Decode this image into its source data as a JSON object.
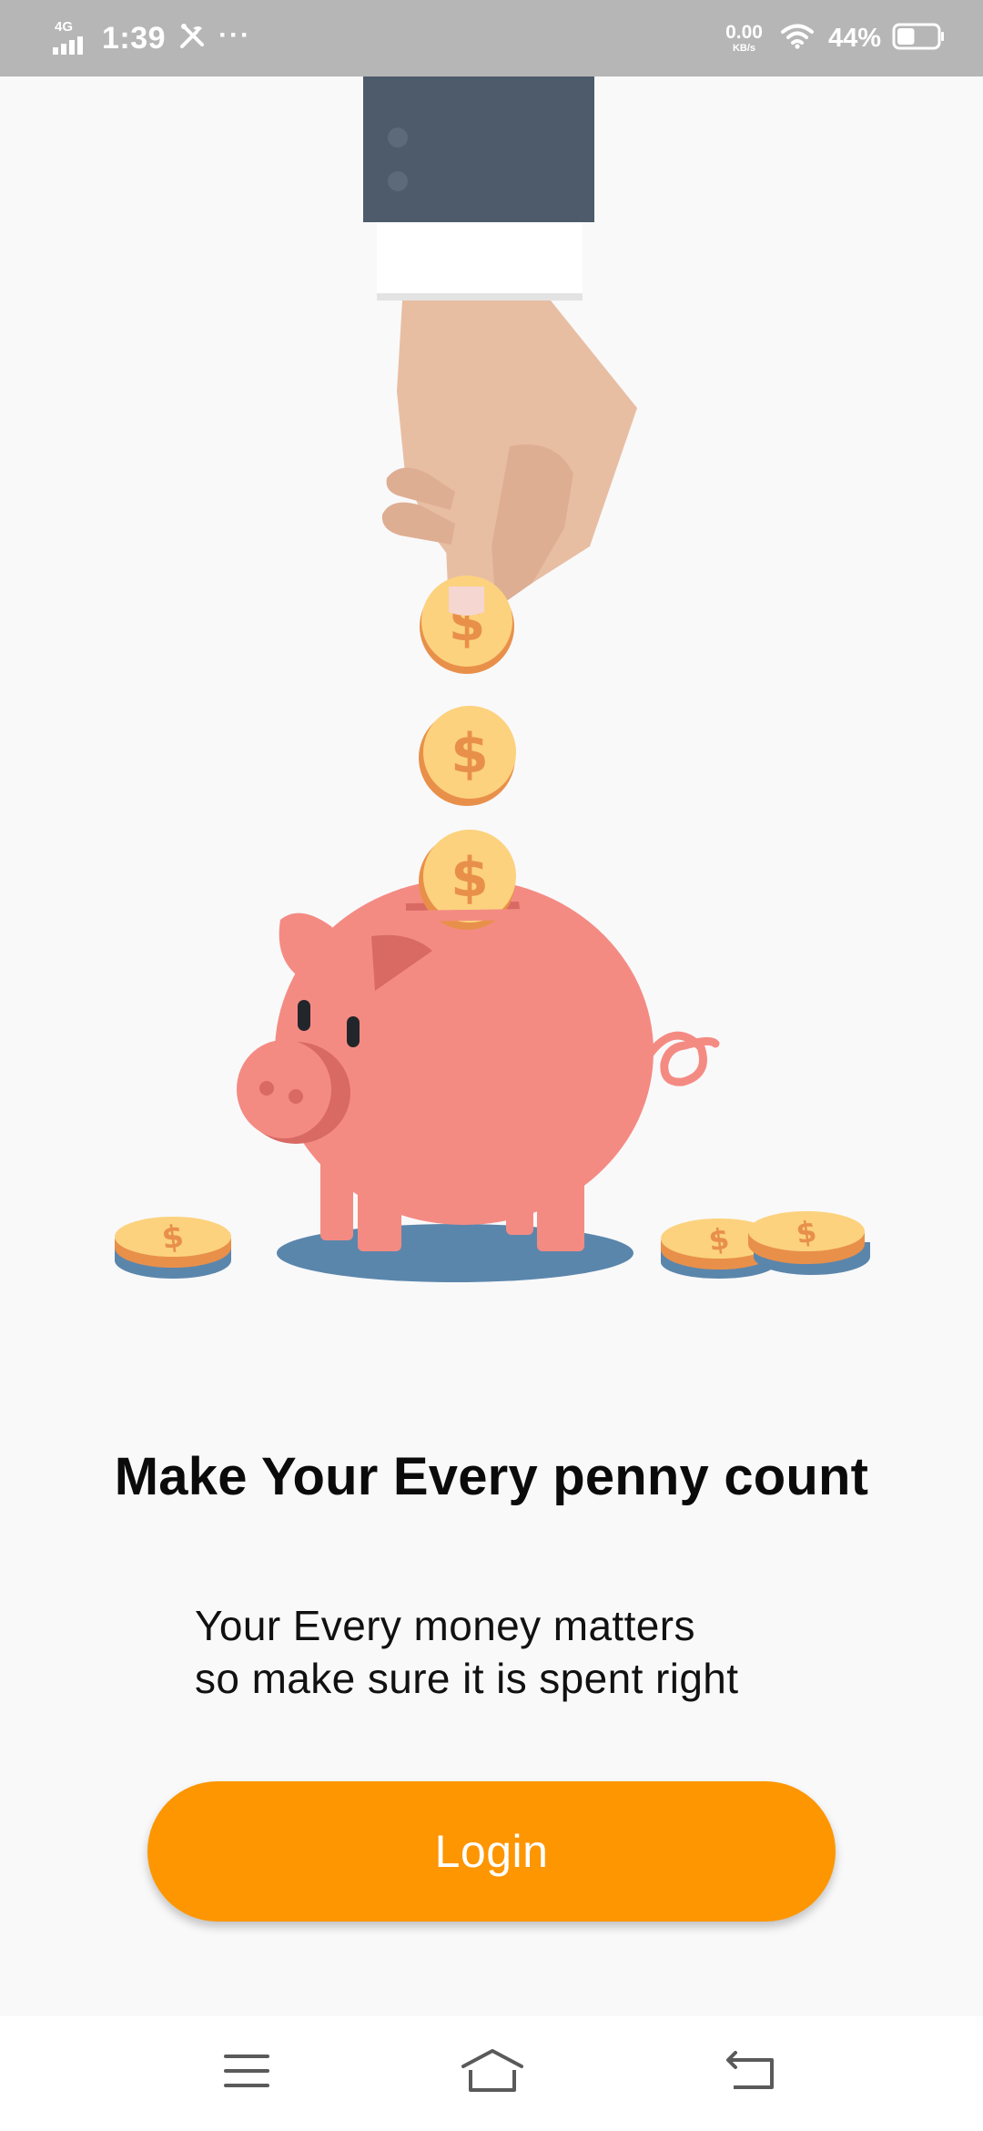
{
  "status_bar": {
    "network": "4G",
    "time": "1:39",
    "overflow": "···",
    "speed_value": "0.00",
    "speed_unit": "KB/s",
    "battery_percent": "44%",
    "battery_level": 0.44,
    "icons": [
      "signal-icon",
      "tools-icon",
      "wifi-icon",
      "battery-icon"
    ]
  },
  "illustration": {
    "coins_label": "$",
    "icons": [
      "hand-icon",
      "coin-icon",
      "piggy-bank-icon",
      "coin-stack-icon"
    ]
  },
  "content": {
    "headline": "Make Your Every penny count",
    "subtext_line1": "Your Every money matters",
    "subtext_line2": "so make sure it is spent right"
  },
  "login_button": {
    "label": "Login"
  },
  "nav_bar": {
    "icons": [
      "menu-icon",
      "home-icon",
      "back-icon"
    ]
  },
  "colors": {
    "status_bar_bg": "#b6b6b6",
    "background": "#f9f9fa",
    "accent": "#fd9600",
    "piggy": "#f48b83",
    "coin": "#fcd27e",
    "coin_symbol": "#e8904a",
    "sleeve": "#4d5b6b",
    "shadow": "#5b86ac"
  }
}
